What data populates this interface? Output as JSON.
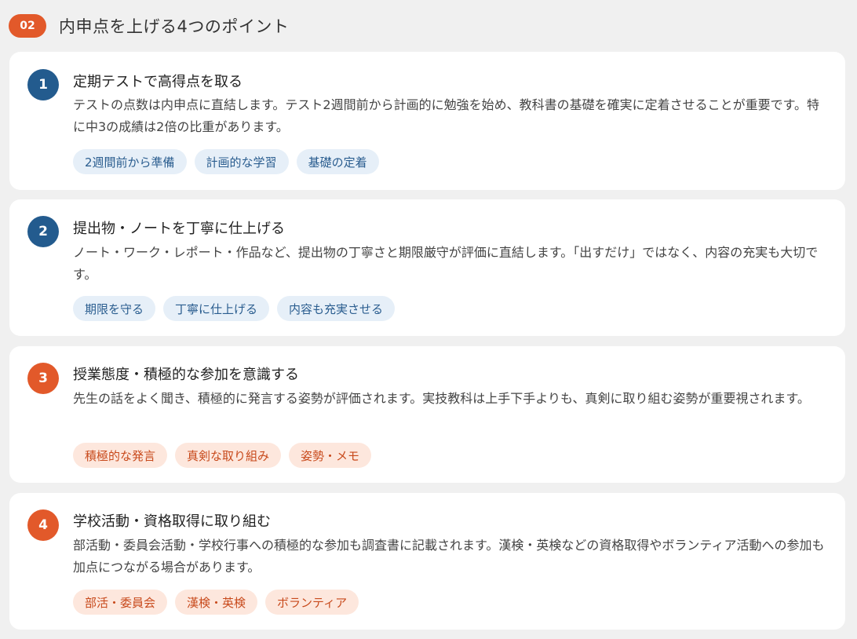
{
  "header": {
    "badge": "02",
    "title": "内申点を上げる4つのポイント"
  },
  "points": [
    {
      "number": "1",
      "title": "定期テストで高得点を取る",
      "description": "テストの点数は内申点に直結します。テスト2週間前から計画的に勉強を始め、教科書の基礎を確実に定着させることが重要です。特に中3の成績は2倍の比重があります。",
      "tags": [
        "2週間前から準備",
        "計画的な学習",
        "基礎の定着"
      ]
    },
    {
      "number": "2",
      "title": "提出物・ノートを丁寧に仕上げる",
      "description": "ノート・ワーク・レポート・作品など、提出物の丁寧さと期限厳守が評価に直結します。「出すだけ」ではなく、内容の充実も大切です。",
      "tags": [
        "期限を守る",
        "丁寧に仕上げる",
        "内容も充実させる"
      ]
    },
    {
      "number": "3",
      "title": "授業態度・積極的な参加を意識する",
      "description": "先生の話をよく聞き、積極的に発言する姿勢が評価されます。実技教科は上手下手よりも、真剣に取り組む姿勢が重要視されます。",
      "tags": [
        "積極的な発言",
        "真剣な取り組み",
        "姿勢・メモ"
      ]
    },
    {
      "number": "4",
      "title": "学校活動・資格取得に取り組む",
      "description": "部活動・委員会活動・学校行事への積極的な参加も調査書に記載されます。漢検・英検などの資格取得やボランティア活動への参加も加点につながる場合があります。",
      "tags": [
        "部活・委員会",
        "漢検・英検",
        "ボランティア"
      ]
    }
  ],
  "colors": {
    "accent_orange": "#e2592a",
    "accent_blue": "#235b8e",
    "tag_blue_bg": "#e6eff8",
    "tag_orange_bg": "#fde7dd"
  }
}
